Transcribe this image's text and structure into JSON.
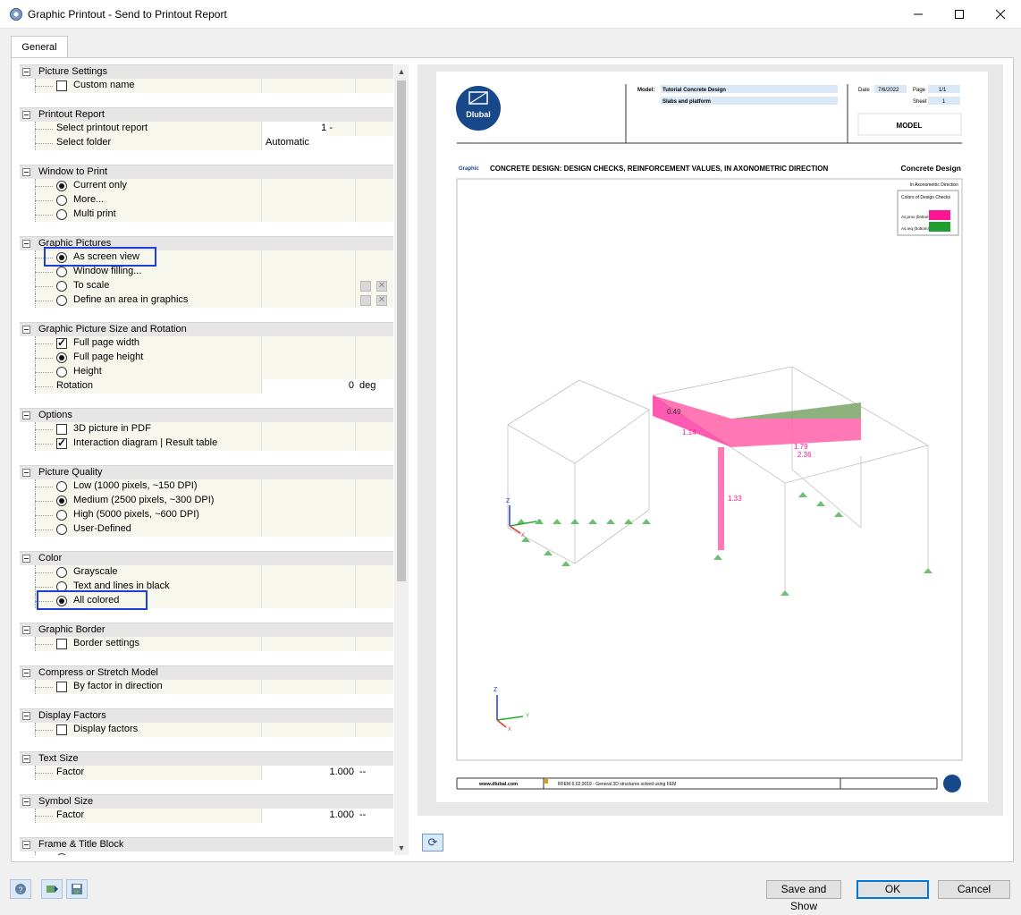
{
  "window": {
    "title": "Graphic Printout - Send to Printout Report",
    "icon": "app-icon"
  },
  "tabs": [
    "General"
  ],
  "settings": {
    "picture_settings": {
      "title": "Picture Settings",
      "custom_name": "Custom name",
      "custom_name_checked": false
    },
    "printout_report": {
      "title": "Printout Report",
      "select_report_label": "Select printout report",
      "select_report_value": "1 -",
      "select_folder_label": "Select folder",
      "select_folder_value": "Automatic"
    },
    "window_to_print": {
      "title": "Window to Print",
      "options": [
        "Current only",
        "More...",
        "Multi print"
      ],
      "selected": 0
    },
    "graphic_pictures": {
      "title": "Graphic Pictures",
      "options": [
        "As screen view",
        "Window filling...",
        "To scale",
        "Define an area in graphics"
      ],
      "selected": 0
    },
    "size_rotation": {
      "title": "Graphic Picture Size and Rotation",
      "full_page_width": "Full page width",
      "full_page_height": "Full page height",
      "height": "Height",
      "rotation_label": "Rotation",
      "rotation_value": "0",
      "rotation_unit": "deg"
    },
    "options": {
      "title": "Options",
      "pdf_3d": "3D picture in PDF",
      "interaction": "Interaction diagram | Result table"
    },
    "picture_quality": {
      "title": "Picture Quality",
      "options": [
        "Low (1000 pixels, ~150 DPI)",
        "Medium (2500 pixels, ~300 DPI)",
        "High (5000 pixels, ~600 DPI)",
        "User-Defined"
      ],
      "selected": 1
    },
    "color": {
      "title": "Color",
      "options": [
        "Grayscale",
        "Text and lines in black",
        "All colored"
      ],
      "selected": 2
    },
    "graphic_border": {
      "title": "Graphic Border",
      "border_settings": "Border settings"
    },
    "compress": {
      "title": "Compress or Stretch Model",
      "by_factor": "By factor in direction"
    },
    "display_factors": {
      "title": "Display Factors",
      "display_factors": "Display factors"
    },
    "text_size": {
      "title": "Text Size",
      "factor_label": "Factor",
      "factor_value": "1.000",
      "unit": "--"
    },
    "symbol_size": {
      "title": "Symbol Size",
      "factor_label": "Factor",
      "factor_value": "1.000",
      "unit": "--"
    },
    "frame_title": {
      "title": "Frame & Title Block"
    }
  },
  "preview": {
    "logo_text": "Dlubal",
    "model_label": "Model:",
    "model_name": "Tutorial Concrete Design",
    "model_sub": "Slabs and platform",
    "date_label": "Date",
    "date_value": "7/6/2022",
    "page_label": "Page",
    "page_value": "1/1",
    "sheet_label": "Sheet",
    "sheet_value": "1",
    "model_box": "MODEL",
    "graphic_label": "Graphic",
    "heading": "CONCRETE DESIGN: DESIGN CHECKS, REINFORCEMENT VALUES, IN AXONOMETRIC DIRECTION",
    "heading_right": "Concrete Design",
    "direction_note": "In Axonometric Direction",
    "legend_title": "Colors of Design Checks",
    "legend_item1": "As,prov (bottom)",
    "legend_item2": "As,req (bottom)",
    "legend_colors": [
      "#ff1493",
      "#1e9e2e"
    ],
    "labels": [
      "0.49",
      "1.14",
      "1.79",
      "2.36",
      "1.33"
    ],
    "axis_x": "X",
    "axis_y": "Y",
    "axis_z": "Z",
    "footer_url": "www.dlubal.com",
    "footer_text": "RFEM 6.02.0019 - General 3D structures solved using FEM"
  },
  "buttons": {
    "save_and_show": "Save and Show",
    "ok": "OK",
    "cancel": "Cancel"
  }
}
